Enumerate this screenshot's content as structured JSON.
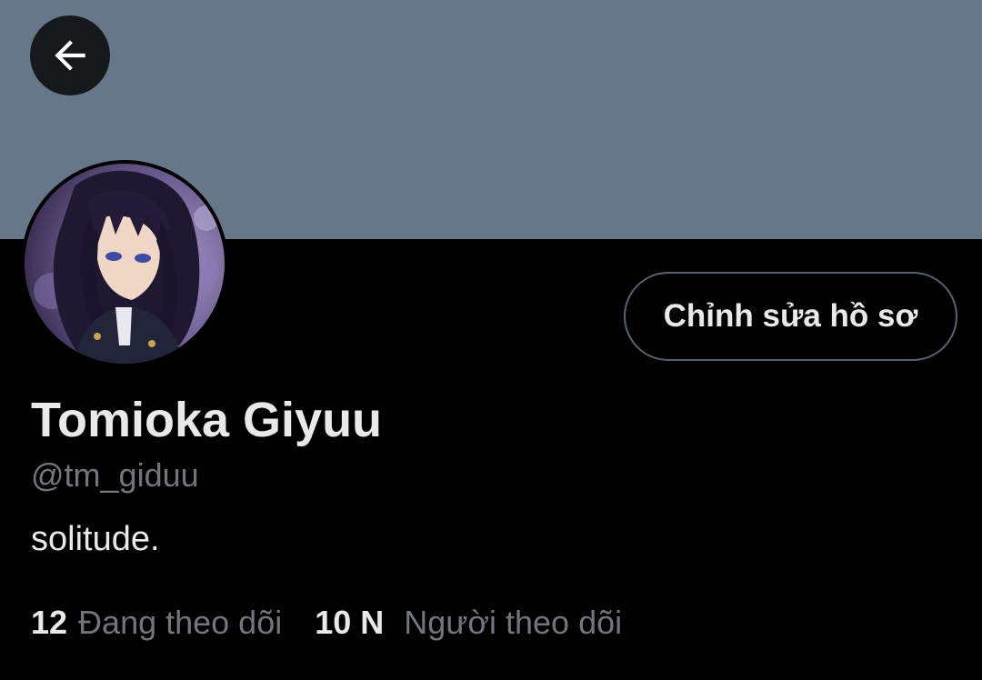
{
  "header": {
    "back_icon": "arrow-left-icon"
  },
  "profile": {
    "display_name": "Tomioka Giyuu",
    "handle": "@tm_giduu",
    "bio": "solitude.",
    "edit_button_label": "Chỉnh sửa hồ sơ"
  },
  "stats": {
    "following": {
      "count": "12",
      "label": "Đang theo dõi"
    },
    "followers": {
      "count": "10 N",
      "label": "Người theo dõi"
    }
  },
  "colors": {
    "banner": "#66778a",
    "background": "#000000",
    "primary_text": "#e7e9ea",
    "secondary_text": "#71767b",
    "button_border": "#536471"
  }
}
